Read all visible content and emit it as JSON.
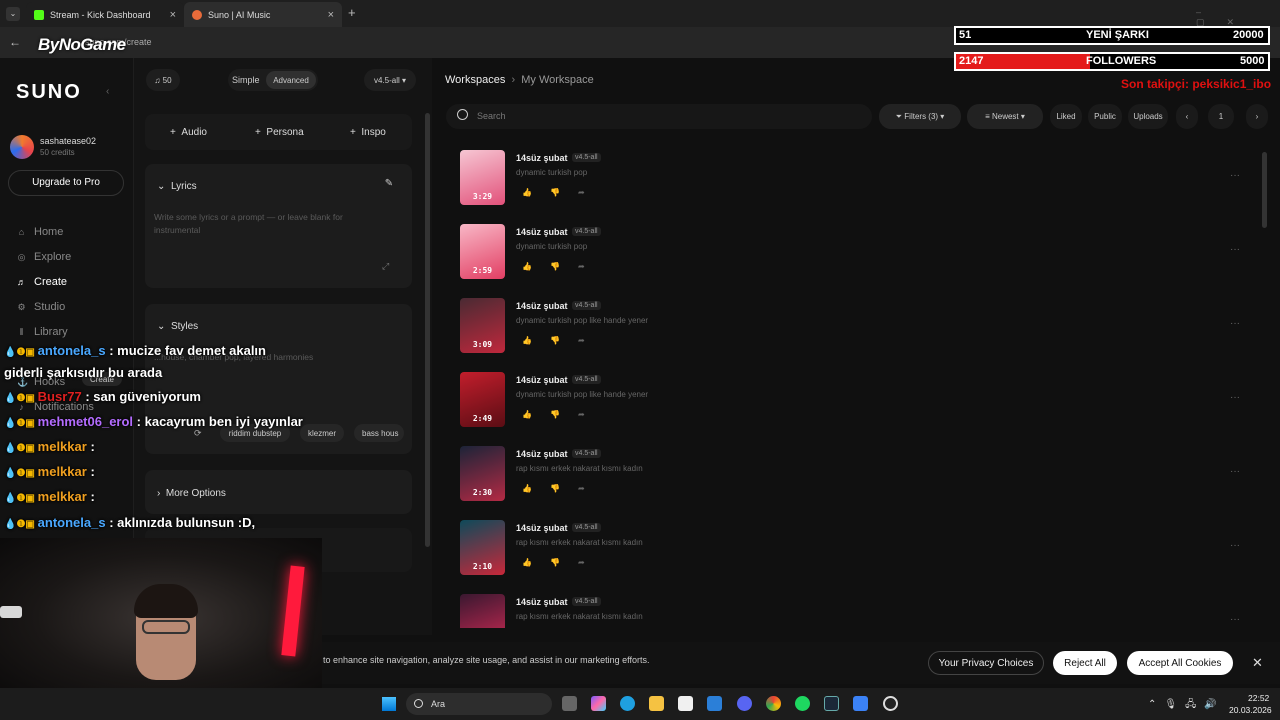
{
  "browser": {
    "tabs": [
      {
        "label": "Stream - Kick Dashboard",
        "icon": "kick-icon",
        "color": "#53fc18"
      },
      {
        "label": "Suno | AI Music",
        "icon": "suno-icon",
        "color": "#e86b3a"
      }
    ],
    "url": "suno.com/create",
    "watermark": "ByNoGame"
  },
  "sidebar": {
    "logo": "SUNO",
    "user_name": "sashatease02",
    "credits": "50 credits",
    "upgrade_label": "Upgrade to Pro",
    "items": [
      {
        "label": "Home",
        "icon": "home-icon"
      },
      {
        "label": "Explore",
        "icon": "compass-icon"
      },
      {
        "label": "Create",
        "icon": "music-note-icon"
      },
      {
        "label": "Studio",
        "icon": "studio-icon"
      },
      {
        "label": "Library",
        "icon": "library-icon"
      },
      {
        "label": "Hooks",
        "icon": "hooks-icon"
      },
      {
        "label": "Notifications",
        "icon": "bell-icon"
      }
    ],
    "hooks_badge": "Create"
  },
  "create": {
    "credit_count": "50",
    "mode_simple": "Simple",
    "mode_advanced": "Advanced",
    "model": "v4.5-all",
    "add_audio": "Audio",
    "add_persona": "Persona",
    "add_inspo": "Inspo",
    "lyrics_label": "Lyrics",
    "lyrics_placeholder": "Write some lyrics or a prompt — or leave blank for instrumental",
    "styles_label": "Styles",
    "styles_text": "...house, chamber pop, layered harmonies",
    "style_tags": [
      "riddim dubstep",
      "klezmer",
      "bass hous"
    ],
    "more_options": "More Options"
  },
  "workspace": {
    "breadcrumb_root": "Workspaces",
    "breadcrumb_current": "My Workspace",
    "search_placeholder": "Search",
    "filters": "Filters (3)",
    "sort": "Newest",
    "liked": "Liked",
    "public": "Public",
    "uploads": "Uploads",
    "page": "1",
    "songs": [
      {
        "title": "14süz şubat",
        "version": "v4.5-all",
        "desc": "dynamic turkish pop",
        "duration": "3:29",
        "c1": "#f6c6d3",
        "c2": "#e2517a"
      },
      {
        "title": "14süz şubat",
        "version": "v4.5-all",
        "desc": "dynamic turkish pop",
        "duration": "2:59",
        "c1": "#f8b7c6",
        "c2": "#e23e63"
      },
      {
        "title": "14süz şubat",
        "version": "v4.5-all",
        "desc": "dynamic turkish pop like hande yener",
        "duration": "3:09",
        "c1": "#4a2a33",
        "c2": "#c0283c"
      },
      {
        "title": "14süz şubat",
        "version": "v4.5-all",
        "desc": "dynamic turkish pop like hande yener",
        "duration": "2:49",
        "c1": "#c21e2c",
        "c2": "#5a0d14"
      },
      {
        "title": "14süz şubat",
        "version": "v4.5-all",
        "desc": "rap kısmı erkek nakarat kısmı kadın",
        "duration": "2:30",
        "c1": "#1c2438",
        "c2": "#b42a44"
      },
      {
        "title": "14süz şubat",
        "version": "v4.5-all",
        "desc": "rap kısmı erkek nakarat kısmı kadın",
        "duration": "2:10",
        "c1": "#0e4a5a",
        "c2": "#c8283a"
      },
      {
        "title": "14süz şubat",
        "version": "v4.5-all",
        "desc": "rap kısmı erkek nakarat kısmı kadın",
        "duration": "",
        "c1": "#3a1830",
        "c2": "#d02a54"
      }
    ]
  },
  "stream_overlay": {
    "songs_count": "51",
    "songs_label": "YENİ ŞARKI",
    "songs_goal": "20000",
    "followers_count": "2147",
    "followers_label": "FOLLOWERS",
    "followers_goal": "5000",
    "followers_progress": 0.43,
    "last_follower": "Son takipçi: peksikic1_ibo",
    "chat": [
      {
        "user": "antonela_s",
        "color": "#4aa8ff",
        "msg": ": mucize fav demet akalın",
        "cont": "giderli şarkısıdır bu arada"
      },
      {
        "user": "Busr77",
        "color": "#e02020",
        "msg": ": san güveniyorum"
      },
      {
        "user": "mehmet06_erol",
        "color": "#b46cff",
        "msg": ": kacayrum ben iyi yayınlar"
      },
      {
        "user": "melkkar",
        "color": "#f0a020",
        "msg": ":"
      },
      {
        "user": "melkkar",
        "color": "#f0a020",
        "msg": ":"
      },
      {
        "user": "melkkar",
        "color": "#f0a020",
        "msg": ":"
      },
      {
        "user": "antonela_s",
        "color": "#4aa8ff",
        "msg": ": aklınızda bulunsun :D,"
      }
    ]
  },
  "cookie": {
    "text": "to enhance site navigation, analyze site usage, and assist in our marketing efforts.",
    "privacy": "Your Privacy Choices",
    "reject": "Reject All",
    "accept": "Accept All Cookies"
  },
  "taskbar": {
    "search": "Ara",
    "time": "22:52",
    "date": "20.03.2026"
  }
}
